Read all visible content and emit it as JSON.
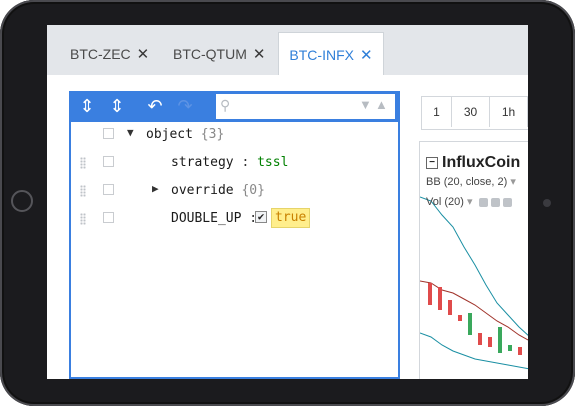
{
  "tabs": [
    {
      "label": "BTC-ZEC",
      "close": "✕"
    },
    {
      "label": "BTC-QTUM",
      "close": "✕"
    },
    {
      "label": "BTC-INFX",
      "close": "✕",
      "active": true
    }
  ],
  "editor": {
    "toolbar": {
      "expand_all_icon": "⇕",
      "collapse_all_icon": "⇕",
      "undo_icon": "↶",
      "redo_icon": "↷",
      "search_placeholder": "",
      "search_prev_icon": "▼",
      "search_next_icon": "▲"
    },
    "root": {
      "expander": "▼",
      "field": "object",
      "meta": "{3}"
    },
    "rows": {
      "strategy": {
        "field": "strategy",
        "separator": ":",
        "value": "tssl"
      },
      "override": {
        "expander": "▶",
        "field": "override",
        "meta": "{0}"
      },
      "double_up": {
        "field": "DOUBLE_UP",
        "separator": ":",
        "checked": "✔",
        "value": "true"
      }
    }
  },
  "chart": {
    "intervals": [
      "1",
      "30",
      "1h"
    ],
    "title": "InfluxCoin",
    "collapse_icon": "−",
    "studies": {
      "bb": "BB (20, close, 2)",
      "vol": "Vol (20)",
      "caret": "▾"
    },
    "colors": {
      "bb_line": "#1a8fa3",
      "ma_line": "#a0332a",
      "down_candle": "#e04b4b",
      "up_candle": "#3aa85c"
    },
    "bb_upper": [
      182,
      186,
      200,
      212,
      232,
      250,
      270,
      288,
      300,
      312,
      322
    ],
    "bb_middle": [
      266,
      268,
      275,
      278,
      284,
      290,
      298,
      306,
      312,
      320,
      326
    ],
    "bb_lower": [
      318,
      322,
      330,
      336,
      340,
      344,
      346,
      348,
      350,
      352,
      354
    ],
    "candles": [
      {
        "o": 268,
        "c": 290,
        "up": false
      },
      {
        "o": 272,
        "c": 295,
        "up": false
      },
      {
        "o": 285,
        "c": 300,
        "up": false
      },
      {
        "o": 300,
        "c": 306,
        "up": false
      },
      {
        "o": 298,
        "c": 320,
        "up": true
      },
      {
        "o": 318,
        "c": 330,
        "up": false
      },
      {
        "o": 322,
        "c": 332,
        "up": false
      },
      {
        "o": 312,
        "c": 338,
        "up": true
      },
      {
        "o": 330,
        "c": 336,
        "up": true
      },
      {
        "o": 332,
        "c": 340,
        "up": false
      }
    ]
  }
}
